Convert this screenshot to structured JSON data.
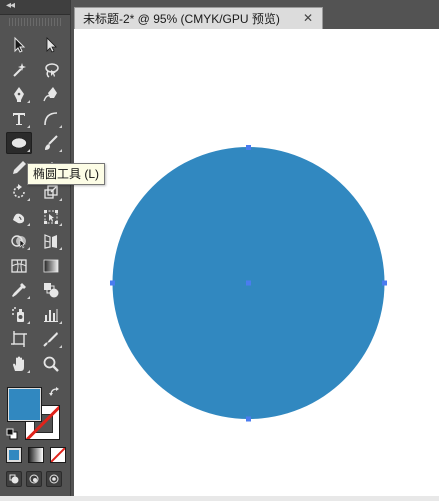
{
  "tools_panel": {
    "collapse_glyph": "◂◂",
    "rows": [
      [
        "selection-tool",
        "direct-selection-tool"
      ],
      [
        "magic-wand-tool",
        "lasso-tool"
      ],
      [
        "pen-tool",
        "curvature-tool"
      ],
      [
        "type-tool",
        "arc-tool"
      ],
      [
        "ellipse-tool",
        "paintbrush-tool"
      ],
      [
        "pencil-tool",
        "eraser-tool"
      ],
      [
        "rotate-tool",
        "scale-tool"
      ],
      [
        "warp-tool",
        "free-transform-tool"
      ],
      [
        "shape-builder-tool",
        "perspective-grid-tool"
      ],
      [
        "mesh-tool",
        "gradient-tool"
      ],
      [
        "eyedropper-tool",
        "blend-tool"
      ],
      [
        "symbol-sprayer-tool",
        "column-graph-tool"
      ],
      [
        "artboard-tool",
        "slice-tool"
      ],
      [
        "hand-tool",
        "zoom-tool"
      ]
    ],
    "active_tool": "ellipse-tool",
    "fill_color": "#3188c0",
    "stroke": "none"
  },
  "document": {
    "tab_title": "未标题-2* @ 95% (CMYK/GPU 预览)",
    "close_glyph": "✕",
    "circle_fill": "#3188c0",
    "selection_color": "#4a7cf0"
  },
  "tooltip": {
    "text": "椭圆工具 (L)"
  }
}
